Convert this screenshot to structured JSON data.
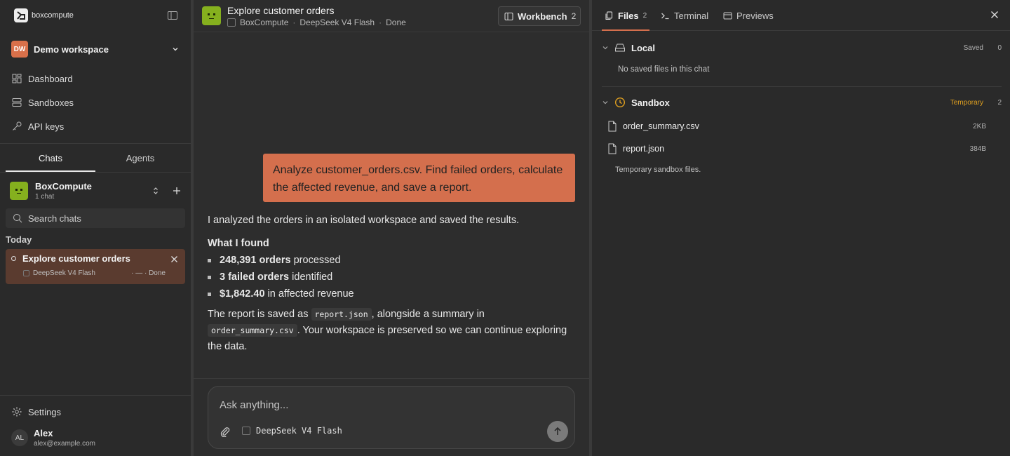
{
  "sidebar": {
    "brand": "boxcompute",
    "workspace": {
      "initials": "DW",
      "name": "Demo workspace"
    },
    "nav": [
      {
        "label": "Dashboard",
        "icon": "dashboard-icon"
      },
      {
        "label": "Sandboxes",
        "icon": "server-icon"
      },
      {
        "label": "API keys",
        "icon": "key-icon"
      }
    ],
    "tabs": {
      "chats": "Chats",
      "agents": "Agents"
    },
    "project": {
      "name": "BoxCompute",
      "count": "1 chat"
    },
    "search_placeholder": "Search chats",
    "group_label": "Today",
    "chat_item": {
      "title": "Explore customer orders",
      "model": "DeepSeek V4 Flash",
      "status": "· — · Done"
    },
    "settings_label": "Settings",
    "user": {
      "initials": "AL",
      "name": "Alex",
      "email": "alex@example.com"
    }
  },
  "chat": {
    "title": "Explore customer orders",
    "meta": {
      "project": "BoxCompute",
      "model": "DeepSeek V4 Flash",
      "status": "Done"
    },
    "workbench": {
      "label": "Workbench",
      "count": "2"
    },
    "user_message": "Analyze customer_orders.csv. Find failed orders, calculate the affected revenue, and save a report.",
    "answer": {
      "intro": "I analyzed the orders in an isolated workspace and saved the results.",
      "heading": "What I found",
      "bullets": [
        {
          "bold": "248,391 orders",
          "rest": " processed"
        },
        {
          "bold": "3 failed orders",
          "rest": " identified"
        },
        {
          "bold": "$1,842.40",
          "rest": " in affected revenue"
        }
      ],
      "outro_1": "The report is saved as ",
      "code_1": "report.json",
      "outro_2": ", alongside a summary in ",
      "code_2": "order_summary.csv",
      "outro_3": ". Your workspace is preserved so we can continue exploring the data."
    },
    "composer": {
      "placeholder": "Ask anything...",
      "model": "DeepSeek V4 Flash"
    }
  },
  "panel": {
    "tabs": [
      {
        "label": "Files",
        "count": "2"
      },
      {
        "label": "Terminal"
      },
      {
        "label": "Previews"
      }
    ],
    "local": {
      "title": "Local",
      "badge": "Saved",
      "count": "0",
      "empty": "No saved files in this chat"
    },
    "sandbox": {
      "title": "Sandbox",
      "badge": "Temporary",
      "count": "2",
      "files": [
        {
          "name": "order_summary.csv",
          "size": "2KB"
        },
        {
          "name": "report.json",
          "size": "384B"
        }
      ],
      "note": "Temporary sandbox files."
    },
    "colors": {
      "accent": "#d46f4d",
      "temporary": "#e0a020"
    }
  }
}
